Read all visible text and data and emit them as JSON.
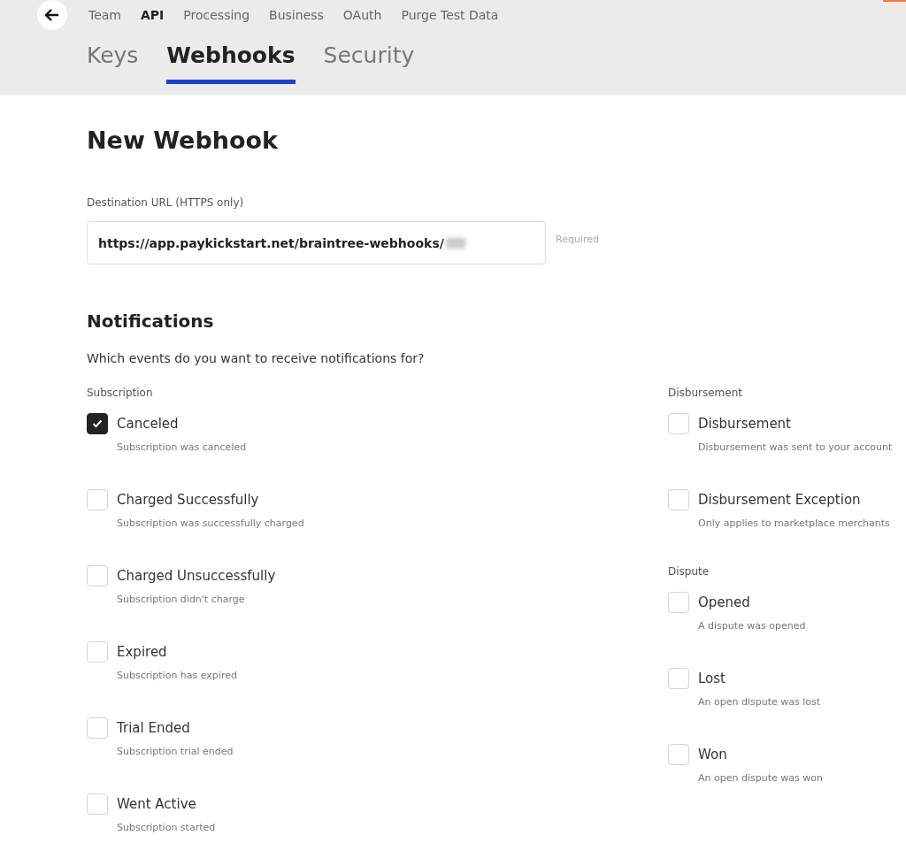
{
  "top_nav": [
    {
      "label": "Team",
      "selected": false
    },
    {
      "label": "API",
      "selected": true
    },
    {
      "label": "Processing",
      "selected": false
    },
    {
      "label": "Business",
      "selected": false
    },
    {
      "label": "OAuth",
      "selected": false
    },
    {
      "label": "Purge Test Data",
      "selected": false
    }
  ],
  "tabs": [
    {
      "label": "Keys",
      "selected": false
    },
    {
      "label": "Webhooks",
      "selected": true
    },
    {
      "label": "Security",
      "selected": false
    }
  ],
  "title": "New Webhook",
  "destination": {
    "label": "Destination URL (HTTPS only)",
    "value": "https://app.paykickstart.net/braintree-webhooks/",
    "hint": "Required"
  },
  "notifications": {
    "heading": "Notifications",
    "question": "Which events do you want to receive notifications for?"
  },
  "columns": [
    {
      "groups": [
        {
          "label": "Subscription",
          "items": [
            {
              "label": "Canceled",
              "description": "Subscription was canceled",
              "checked": true
            },
            {
              "label": "Charged Successfully",
              "description": "Subscription was successfully charged",
              "checked": false
            },
            {
              "label": "Charged Unsuccessfully",
              "description": "Subscription didn't charge",
              "checked": false
            },
            {
              "label": "Expired",
              "description": "Subscription has expired",
              "checked": false
            },
            {
              "label": "Trial Ended",
              "description": "Subscription trial ended",
              "checked": false
            },
            {
              "label": "Went Active",
              "description": "Subscription started",
              "checked": false
            }
          ]
        }
      ]
    },
    {
      "groups": [
        {
          "label": "Disbursement",
          "items": [
            {
              "label": "Disbursement",
              "description": "Disbursement was sent to your account",
              "checked": false
            },
            {
              "label": "Disbursement Exception",
              "description": "Only applies to marketplace merchants",
              "checked": false
            }
          ]
        },
        {
          "label": "Dispute",
          "items": [
            {
              "label": "Opened",
              "description": "A dispute was opened",
              "checked": false
            },
            {
              "label": "Lost",
              "description": "An open dispute was lost",
              "checked": false
            },
            {
              "label": "Won",
              "description": "An open dispute was won",
              "checked": false
            }
          ]
        }
      ]
    }
  ]
}
